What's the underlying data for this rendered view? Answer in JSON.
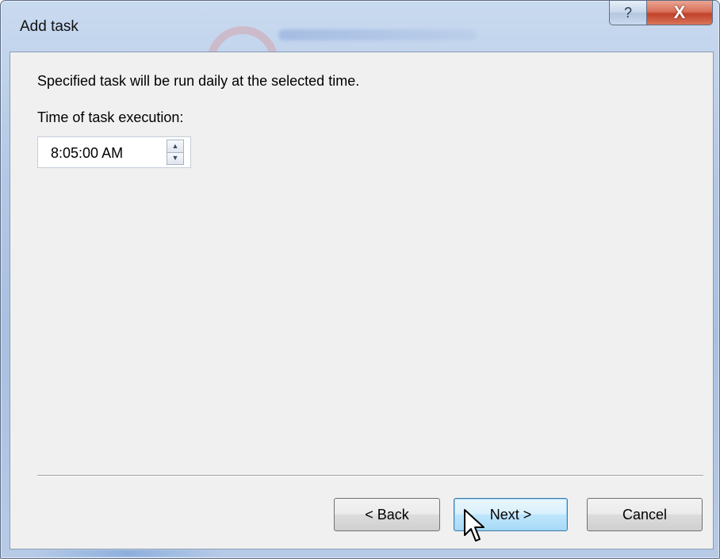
{
  "window": {
    "title": "Add task"
  },
  "caption_buttons": {
    "help_glyph": "?",
    "close_glyph": "X"
  },
  "content": {
    "description": "Specified task will be run daily at the selected time.",
    "time_label": "Time of task execution:",
    "time_value": "8:05:00 AM"
  },
  "buttons": {
    "back_label": "< Back",
    "next_label": "Next >",
    "cancel_label": "Cancel"
  },
  "icons": {
    "help": "help-icon",
    "close": "close-icon",
    "spin_up": "spin-up-icon",
    "spin_down": "spin-down-icon",
    "cursor": "mouse-pointer-icon"
  },
  "colors": {
    "title_glass": "#b4c9e6",
    "client_bg": "#f0f0f0",
    "close_red": "#c2412a",
    "focused_button": "#bee6fd"
  }
}
